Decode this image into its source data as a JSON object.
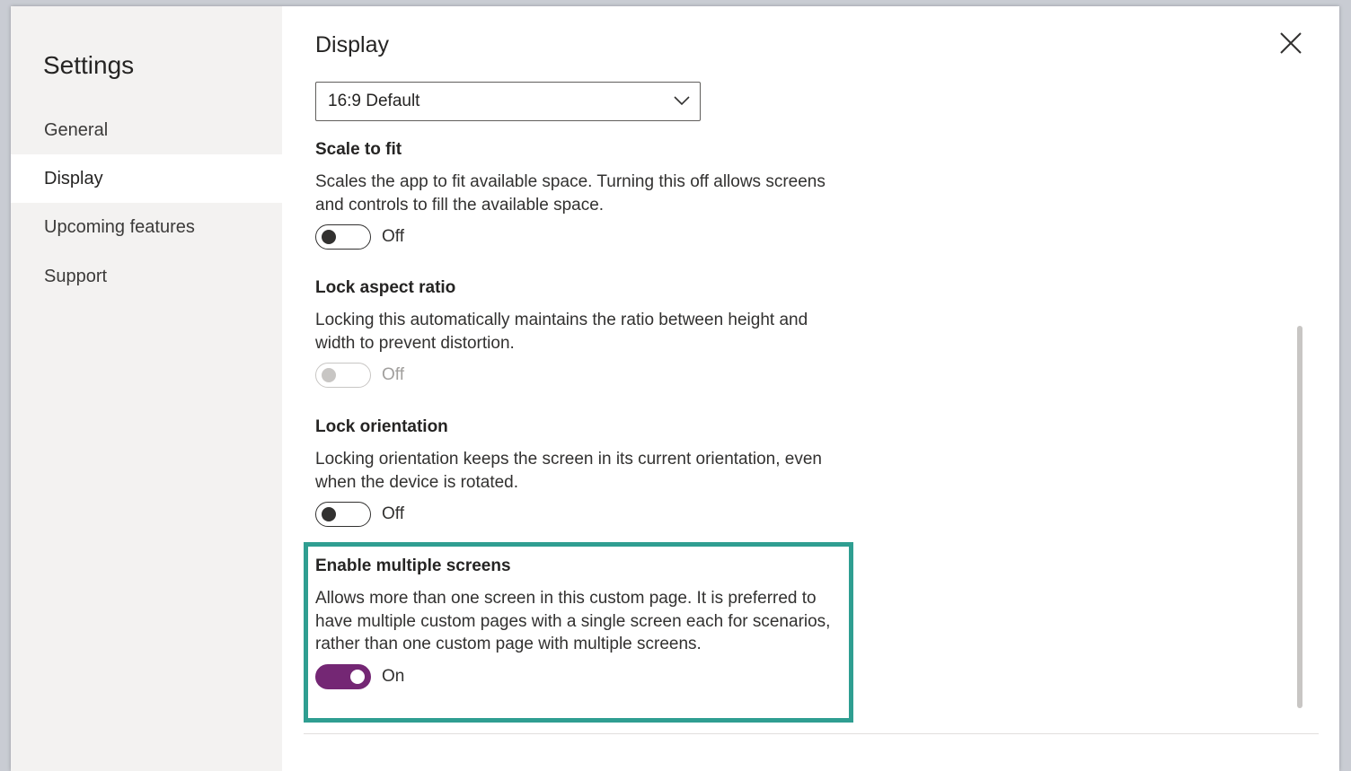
{
  "sidebar": {
    "title": "Settings",
    "items": [
      {
        "label": "General"
      },
      {
        "label": "Display"
      },
      {
        "label": "Upcoming features"
      },
      {
        "label": "Support"
      }
    ],
    "active_item": "Display"
  },
  "main": {
    "title": "Display",
    "dropdown": {
      "selected": "16:9 Default"
    },
    "settings": [
      {
        "title": "Scale to fit",
        "description": "Scales the app to fit available space. Turning this off allows screens and controls to fill the available space.",
        "state": "Off",
        "enabled": true
      },
      {
        "title": "Lock aspect ratio",
        "description": "Locking this automatically maintains the ratio between height and width to prevent distortion.",
        "state": "Off",
        "enabled": false
      },
      {
        "title": "Lock orientation",
        "description": "Locking orientation keeps the screen in its current orientation, even when the device is rotated.",
        "state": "Off",
        "enabled": true
      },
      {
        "title": "Enable multiple screens",
        "description": "Allows more than one screen in this custom page. It is preferred to have multiple custom pages with a single screen each for scenarios, rather than one custom page with multiple screens.",
        "state": "On",
        "enabled": true
      }
    ]
  },
  "colors": {
    "accent": "#742774",
    "highlight_border": "#2f9e91",
    "sidebar_bg": "#f3f2f1"
  },
  "icons": {
    "close": "close-icon",
    "dropdown": "chevron-down-icon"
  }
}
